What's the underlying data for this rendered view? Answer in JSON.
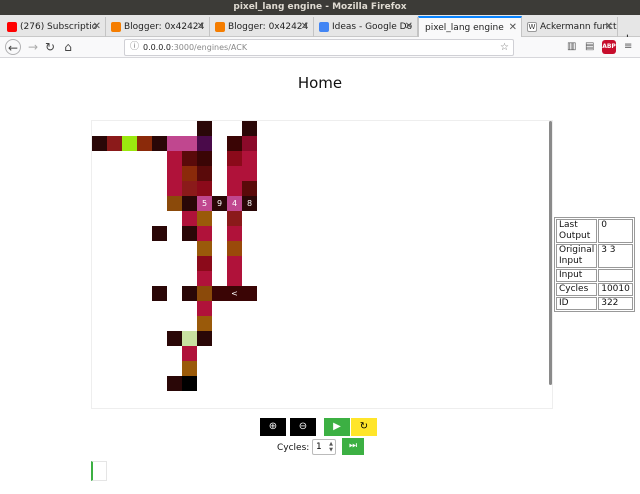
{
  "window": {
    "title": "pixel_lang engine - Mozilla Firefox"
  },
  "tabs": [
    {
      "label": "(276) Subscriptio",
      "icon": "youtube-icon",
      "color": "#ff0000",
      "active": false
    },
    {
      "label": "Blogger: 0x42424",
      "icon": "blogger-icon",
      "color": "#f57d00",
      "active": false
    },
    {
      "label": "Blogger: 0x42424",
      "icon": "blogger-icon",
      "color": "#f57d00",
      "active": false
    },
    {
      "label": "Ideas - Google Do",
      "icon": "google-docs-icon",
      "color": "#4285f4",
      "active": false
    },
    {
      "label": "pixel_lang engine",
      "icon": "",
      "color": "",
      "active": true
    },
    {
      "label": "Ackermann functi",
      "icon": "wikipedia-icon",
      "color": "#333333",
      "active": false
    }
  ],
  "navbar": {
    "url_host": "0.0.0.0",
    "url_path": ":3000/engines/ACK"
  },
  "page": {
    "title": "Home"
  },
  "grid": {
    "cells": [
      {
        "c": 7,
        "r": 0,
        "color": "#2a0707"
      },
      {
        "c": 10,
        "r": 0,
        "color": "#2a0707"
      },
      {
        "c": 0,
        "r": 1,
        "color": "#2a0707"
      },
      {
        "c": 1,
        "r": 1,
        "color": "#8b1a1a"
      },
      {
        "c": 2,
        "r": 1,
        "color": "#9be80f"
      },
      {
        "c": 3,
        "r": 1,
        "color": "#8b2a0a"
      },
      {
        "c": 4,
        "r": 1,
        "color": "#2a0707"
      },
      {
        "c": 5,
        "r": 1,
        "color": "#c0478f"
      },
      {
        "c": 6,
        "r": 1,
        "color": "#c0478f"
      },
      {
        "c": 7,
        "r": 1,
        "color": "#4a0a4a"
      },
      {
        "c": 9,
        "r": 1,
        "color": "#3a0505"
      },
      {
        "c": 10,
        "r": 1,
        "color": "#8b0a2a"
      },
      {
        "c": 5,
        "r": 2,
        "color": "#b0123a"
      },
      {
        "c": 6,
        "r": 2,
        "color": "#5a0a0a"
      },
      {
        "c": 7,
        "r": 2,
        "color": "#3a0505"
      },
      {
        "c": 9,
        "r": 2,
        "color": "#8b0a1a"
      },
      {
        "c": 10,
        "r": 2,
        "color": "#b0123a"
      },
      {
        "c": 5,
        "r": 3,
        "color": "#b0123a"
      },
      {
        "c": 6,
        "r": 3,
        "color": "#8b2a0a"
      },
      {
        "c": 7,
        "r": 3,
        "color": "#5a0a0a"
      },
      {
        "c": 9,
        "r": 3,
        "color": "#b0123a"
      },
      {
        "c": 10,
        "r": 3,
        "color": "#b0123a"
      },
      {
        "c": 5,
        "r": 4,
        "color": "#b0123a"
      },
      {
        "c": 6,
        "r": 4,
        "color": "#8b1a1a"
      },
      {
        "c": 7,
        "r": 4,
        "color": "#8b0a1a"
      },
      {
        "c": 9,
        "r": 4,
        "color": "#b0123a"
      },
      {
        "c": 10,
        "r": 4,
        "color": "#5a0a0a"
      },
      {
        "c": 5,
        "r": 5,
        "color": "#8b4a0a"
      },
      {
        "c": 6,
        "r": 5,
        "color": "#2a0707"
      },
      {
        "c": 7,
        "r": 5,
        "color": "#c0478f",
        "label": "5"
      },
      {
        "c": 8,
        "r": 5,
        "color": "#2a0707",
        "label": "9"
      },
      {
        "c": 9,
        "r": 5,
        "color": "#c0478f",
        "label": "4"
      },
      {
        "c": 10,
        "r": 5,
        "color": "#2a0707",
        "label": "8"
      },
      {
        "c": 6,
        "r": 6,
        "color": "#b0123a"
      },
      {
        "c": 7,
        "r": 6,
        "color": "#9a5a0a"
      },
      {
        "c": 9,
        "r": 6,
        "color": "#8b1a1a"
      },
      {
        "c": 4,
        "r": 7,
        "color": "#2a0707"
      },
      {
        "c": 6,
        "r": 7,
        "color": "#2a0707"
      },
      {
        "c": 7,
        "r": 7,
        "color": "#b0123a"
      },
      {
        "c": 9,
        "r": 7,
        "color": "#b0123a"
      },
      {
        "c": 7,
        "r": 8,
        "color": "#9a5a0a"
      },
      {
        "c": 9,
        "r": 8,
        "color": "#9a4a0a"
      },
      {
        "c": 7,
        "r": 9,
        "color": "#8b0a1a"
      },
      {
        "c": 9,
        "r": 9,
        "color": "#b0123a"
      },
      {
        "c": 7,
        "r": 10,
        "color": "#b0123a"
      },
      {
        "c": 9,
        "r": 10,
        "color": "#b0123a"
      },
      {
        "c": 4,
        "r": 11,
        "color": "#2a0707"
      },
      {
        "c": 6,
        "r": 11,
        "color": "#2a0707"
      },
      {
        "c": 7,
        "r": 11,
        "color": "#8b4a0a"
      },
      {
        "c": 8,
        "r": 11,
        "color": "#3a0505"
      },
      {
        "c": 9,
        "r": 11,
        "color": "#3a0505",
        "label": "<"
      },
      {
        "c": 10,
        "r": 11,
        "color": "#3a0505"
      },
      {
        "c": 7,
        "r": 12,
        "color": "#b0123a"
      },
      {
        "c": 7,
        "r": 13,
        "color": "#9a5a0a"
      },
      {
        "c": 5,
        "r": 14,
        "color": "#2a0707"
      },
      {
        "c": 6,
        "r": 14,
        "color": "#c8e0a0"
      },
      {
        "c": 7,
        "r": 14,
        "color": "#2a0707"
      },
      {
        "c": 6,
        "r": 15,
        "color": "#b0123a"
      },
      {
        "c": 6,
        "r": 16,
        "color": "#9a5a0a"
      },
      {
        "c": 5,
        "r": 17,
        "color": "#2a0707"
      },
      {
        "c": 6,
        "r": 17,
        "color": "#000000"
      }
    ]
  },
  "info": {
    "rows": [
      {
        "key": "Last Output",
        "value": "0"
      },
      {
        "key": "Original Input",
        "value": "3 3"
      },
      {
        "key": "Input",
        "value": ""
      },
      {
        "key": "Cycles",
        "value": "10010"
      },
      {
        "key": "ID",
        "value": "322"
      }
    ]
  },
  "controls": {
    "zoom_in_icon": "zoom-in-icon",
    "zoom_out_icon": "zoom-out-icon",
    "play_icon": "play-icon",
    "reset_icon": "reset-icon",
    "cycles_label": "Cycles:",
    "cycles_value": "1",
    "run_cycles_icon": "step-forward-icon",
    "colors": {
      "zoom": "#000000",
      "play": "#3cb043",
      "reset": "#ffe52a"
    }
  }
}
